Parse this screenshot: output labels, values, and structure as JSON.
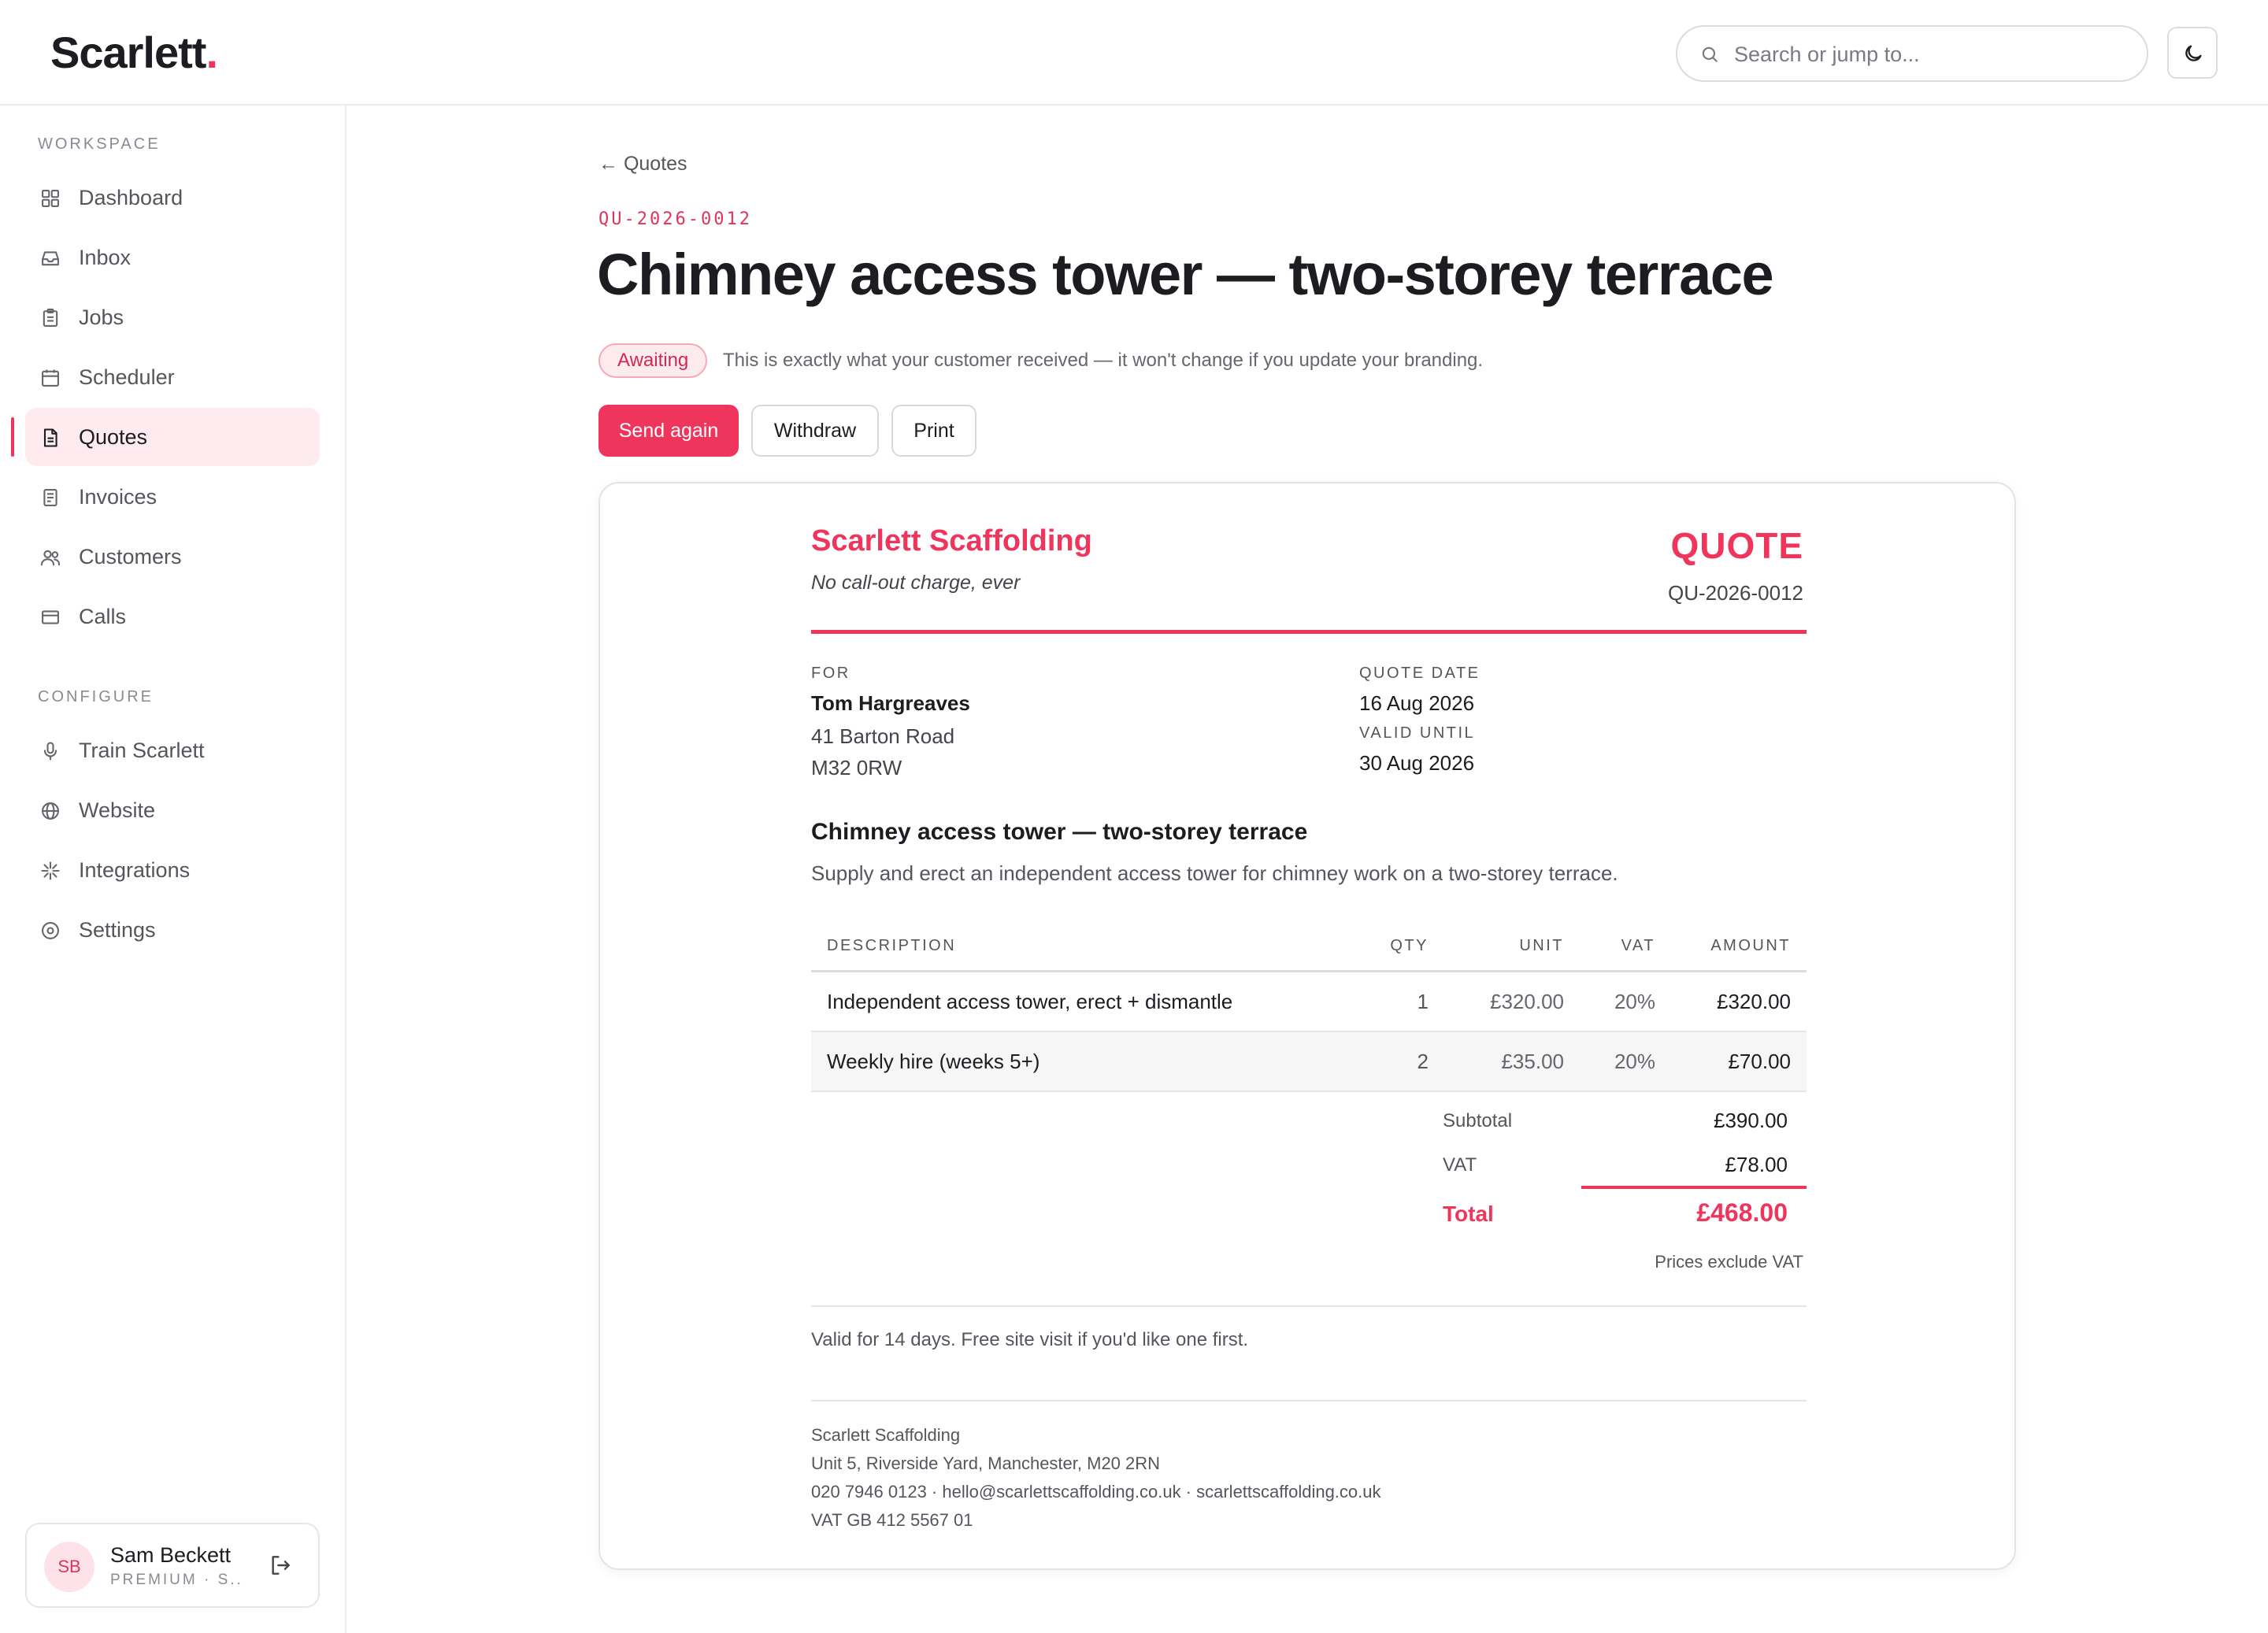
{
  "app": {
    "logo_text": "Scarlett",
    "logo_dot": ".",
    "accent": "#f0355d"
  },
  "search": {
    "placeholder": "Search or jump to..."
  },
  "theme_toggle": {
    "icon": "moon-icon"
  },
  "sidebar": {
    "workspace_label": "WORKSPACE",
    "configure_label": "CONFIGURE",
    "workspace_items": [
      {
        "label": "Dashboard",
        "icon": "grid-icon"
      },
      {
        "label": "Inbox",
        "icon": "inbox-icon"
      },
      {
        "label": "Jobs",
        "icon": "clipboard-icon"
      },
      {
        "label": "Scheduler",
        "icon": "calendar-icon"
      },
      {
        "label": "Quotes",
        "icon": "document-icon",
        "active": true
      },
      {
        "label": "Invoices",
        "icon": "receipt-icon"
      },
      {
        "label": "Customers",
        "icon": "users-icon"
      },
      {
        "label": "Calls",
        "icon": "card-icon"
      }
    ],
    "configure_items": [
      {
        "label": "Train Scarlett",
        "icon": "microphone-icon"
      },
      {
        "label": "Website",
        "icon": "globe-icon"
      },
      {
        "label": "Integrations",
        "icon": "sparkle-icon"
      },
      {
        "label": "Settings",
        "icon": "settings-icon"
      }
    ],
    "user": {
      "initials": "SB",
      "name": "Sam Beckett",
      "plan": "PREMIUM · S..."
    }
  },
  "main": {
    "back_label": "← Quotes",
    "quote_code": "QU-2026-0012",
    "title": "Chimney access tower — two-storey terrace",
    "status_badge": "Awaiting",
    "status_note": "This is exactly what your customer received — it won't change if you update your branding.",
    "actions": {
      "send_again": "Send again",
      "withdraw": "Withdraw",
      "print": "Print"
    }
  },
  "document": {
    "company_name": "Scarlett Scaffolding",
    "company_tagline": "No call-out charge, ever",
    "doc_type": "QUOTE",
    "doc_number": "QU-2026-0012",
    "for_label": "FOR",
    "customer_name": "Tom Hargreaves",
    "address_line1": "41 Barton Road",
    "address_line2": "M32 0RW",
    "quote_date_label": "QUOTE DATE",
    "quote_date": "16 Aug 2026",
    "valid_until_label": "VALID UNTIL",
    "valid_until": "30 Aug 2026",
    "job_title": "Chimney access tower — two-storey terrace",
    "job_description": "Supply and erect an independent access tower for chimney work on a two-storey terrace.",
    "columns": {
      "description": "DESCRIPTION",
      "qty": "QTY",
      "unit": "UNIT",
      "vat": "VAT",
      "amount": "AMOUNT"
    },
    "lines": [
      {
        "description": "Independent access tower, erect + dismantle",
        "qty": "1",
        "unit": "£320.00",
        "vat": "20%",
        "amount": "£320.00"
      },
      {
        "description": "Weekly hire (weeks 5+)",
        "qty": "2",
        "unit": "£35.00",
        "vat": "20%",
        "amount": "£70.00"
      }
    ],
    "subtotal_label": "Subtotal",
    "subtotal": "£390.00",
    "vat_label": "VAT",
    "vat_total": "£78.00",
    "total_label": "Total",
    "total": "£468.00",
    "prices_note": "Prices exclude VAT",
    "terms": "Valid for 14 days. Free site visit if you'd like one first.",
    "footer": {
      "name": "Scarlett Scaffolding",
      "address": "Unit 5, Riverside Yard, Manchester, M20 2RN",
      "contact": "020 7946 0123 · hello@scarlettscaffolding.co.uk · scarlettscaffolding.co.uk",
      "vat_number": "VAT GB 412 5567 01"
    }
  }
}
